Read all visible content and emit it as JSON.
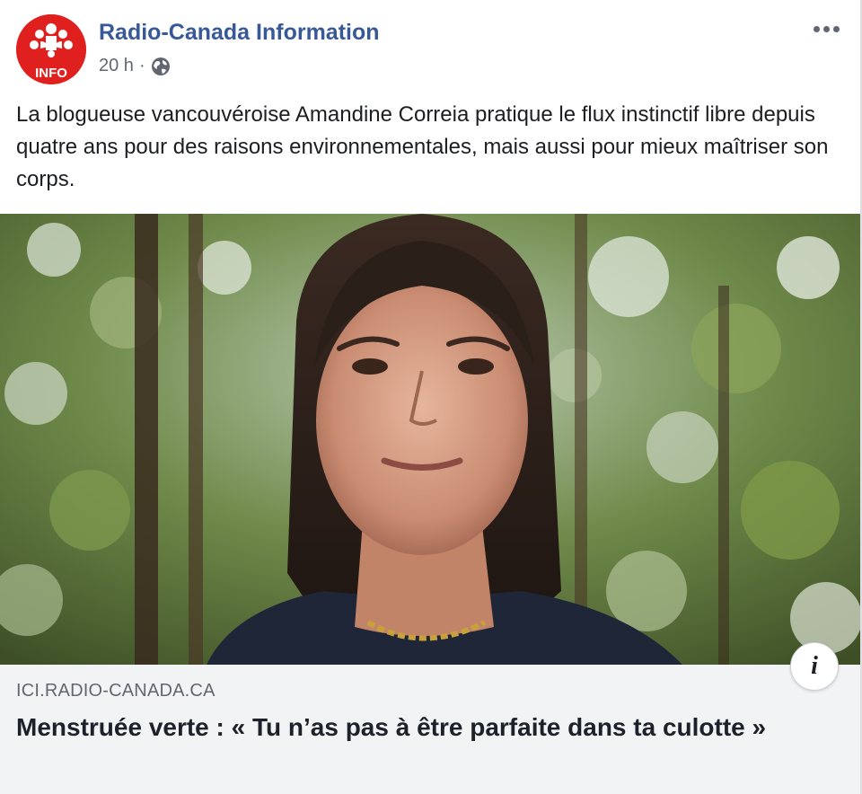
{
  "post": {
    "page_name": "Radio-Canada Information",
    "avatar_badge": "INFO",
    "time": "20 h",
    "separator": "·",
    "audience_icon": "globe-icon",
    "more_icon": "more-options-icon",
    "message": "La blogueuse vancouvéroise Amandine Correia pratique le flux instinctif libre depuis quatre ans pour des raisons environnementales, mais aussi pour mieux maîtriser son corps."
  },
  "link_preview": {
    "domain": "ICI.RADIO-CANADA.CA",
    "title": "Menstruée verte : « Tu n’as pas à être parfaite dans ta culotte »",
    "info_label": "i"
  },
  "colors": {
    "brand_red": "#e0201e",
    "page_name": "#385898",
    "preview_bg": "#f2f3f5"
  }
}
